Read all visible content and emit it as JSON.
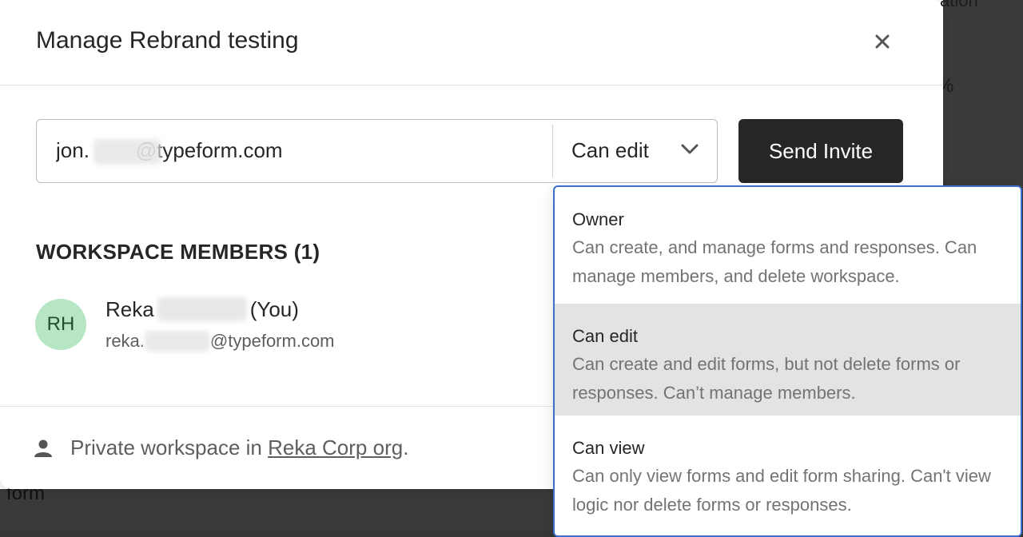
{
  "background": {
    "top_fragment": "ation",
    "pct_fragment": "%",
    "bottom_fragment": "form"
  },
  "modal": {
    "title": "Manage Rebrand testing",
    "close_label": "×"
  },
  "invite": {
    "email_value": "jon.        @typeform.com",
    "role_value": "Can edit",
    "send_label": "Send Invite"
  },
  "members": {
    "heading": "WORKSPACE MEMBERS (1)",
    "list": [
      {
        "initials": "RH",
        "first_name": "Reka",
        "you_label": "(You)",
        "email_prefix": "reka.",
        "email_domain": "@typeform.com",
        "avatar_color": "#b7e6c5"
      }
    ]
  },
  "footer": {
    "text_prefix": "Private workspace in ",
    "org_link": "Reka Corp org",
    "text_suffix": "."
  },
  "role_menu": {
    "options": [
      {
        "title": "Owner",
        "description": "Can create, and manage forms and responses. Can manage members, and delete workspace.",
        "selected": false
      },
      {
        "title": "Can edit",
        "description": "Can create and edit forms, but not delete forms or responses. Can’t manage members.",
        "selected": true
      },
      {
        "title": "Can view",
        "description": "Can only view forms and edit form sharing. Can't view logic nor delete forms or responses.",
        "selected": false
      }
    ]
  },
  "colors": {
    "primary_button": "#262626",
    "menu_border": "#3c6ed0",
    "selected_option": "#e3e3e3",
    "overlay": "#363636"
  }
}
